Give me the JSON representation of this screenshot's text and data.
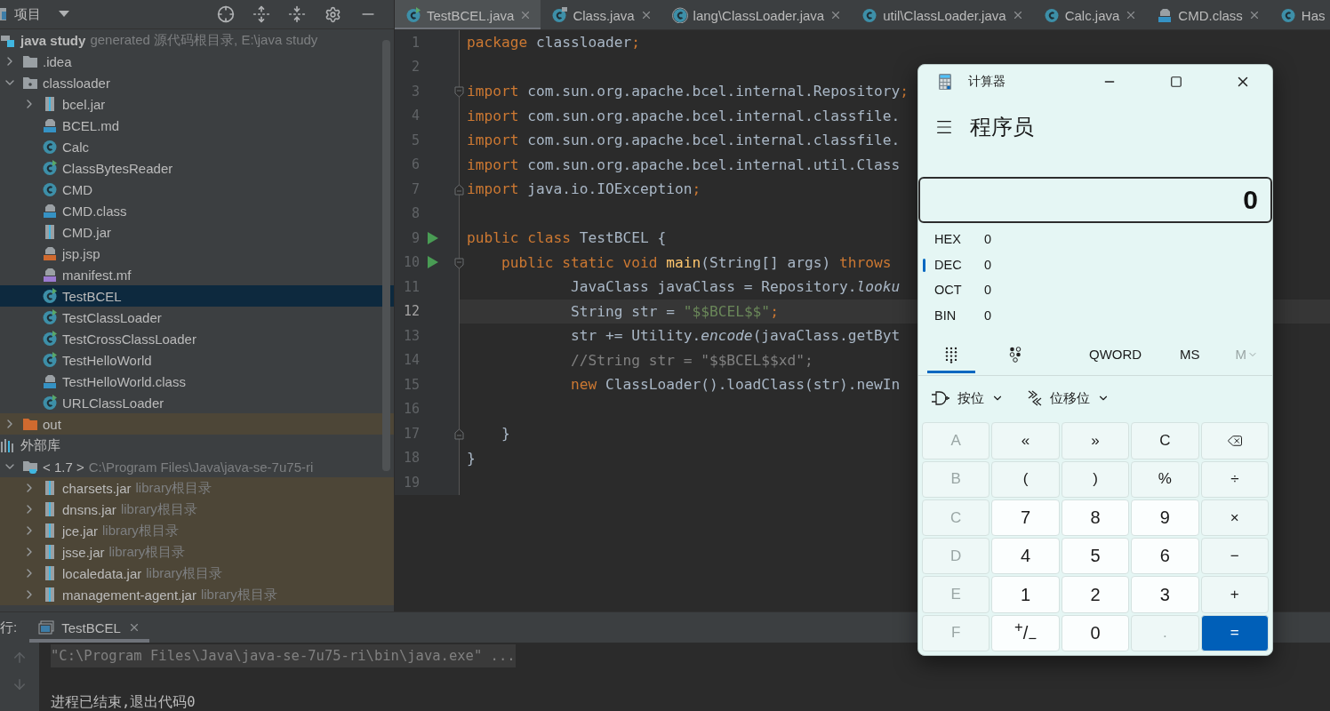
{
  "project_panel": {
    "title": "项目",
    "tree": [
      {
        "name": "java study",
        "hint": "generated 源代码根目录, E:\\java study",
        "kind": "module",
        "selected": false,
        "children": [
          {
            "name": ".idea",
            "kind": "folder",
            "expanded": false,
            "selected": false
          },
          {
            "name": "classloader",
            "kind": "package",
            "expanded": true,
            "selected": false,
            "children": [
              {
                "name": "bcel.jar",
                "kind": "jar",
                "expanded": false,
                "selected": false
              },
              {
                "name": "BCEL.md",
                "kind": "md",
                "selected": false
              },
              {
                "name": "Calc",
                "kind": "class",
                "selected": false
              },
              {
                "name": "ClassBytesReader",
                "kind": "class-runnable",
                "selected": false
              },
              {
                "name": "CMD",
                "kind": "class",
                "selected": false
              },
              {
                "name": "CMD.class",
                "kind": "binary",
                "selected": false
              },
              {
                "name": "CMD.jar",
                "kind": "jar",
                "selected": false
              },
              {
                "name": "jsp.jsp",
                "kind": "jsp",
                "selected": false
              },
              {
                "name": "manifest.mf",
                "kind": "mf",
                "selected": false
              },
              {
                "name": "TestBCEL",
                "kind": "class-runnable",
                "selected": true
              },
              {
                "name": "TestClassLoader",
                "kind": "class-runnable",
                "selected": false
              },
              {
                "name": "TestCrossClassLoader",
                "kind": "class-runnable",
                "selected": false
              },
              {
                "name": "TestHelloWorld",
                "kind": "class-runnable",
                "selected": false
              },
              {
                "name": "TestHelloWorld.class",
                "kind": "binary",
                "selected": false
              },
              {
                "name": "URLClassLoader",
                "kind": "class-runnable",
                "selected": false
              }
            ]
          },
          {
            "name": "out",
            "kind": "excluded",
            "expanded": false,
            "selected": false,
            "tinted": true
          }
        ]
      },
      {
        "name": "外部库",
        "kind": "libraries",
        "selected": false,
        "children": [
          {
            "name": "< 1.7 >",
            "hint": "C:\\Program Files\\Java\\java-se-7u75-ri",
            "kind": "jdk",
            "expanded": true,
            "selected": false,
            "children": [
              {
                "name": "charsets.jar",
                "hint": "library根目录",
                "kind": "jar",
                "expanded": false,
                "selected": false,
                "tinted": true
              },
              {
                "name": "dnsns.jar",
                "hint": "library根目录",
                "kind": "jar",
                "expanded": false,
                "selected": false,
                "tinted": true
              },
              {
                "name": "jce.jar",
                "hint": "library根目录",
                "kind": "jar",
                "expanded": false,
                "selected": false,
                "tinted": true
              },
              {
                "name": "jsse.jar",
                "hint": "library根目录",
                "kind": "jar",
                "expanded": false,
                "selected": false,
                "tinted": true
              },
              {
                "name": "localedata.jar",
                "hint": "library根目录",
                "kind": "jar",
                "expanded": false,
                "selected": false,
                "tinted": true
              },
              {
                "name": "management-agent.jar",
                "hint": "library根目录",
                "kind": "jar",
                "expanded": false,
                "selected": false,
                "tinted": true
              }
            ]
          }
        ]
      }
    ]
  },
  "editor": {
    "tabs": [
      {
        "label": "TestBCEL.java",
        "kind": "class-runnable",
        "selected": true,
        "closable": true
      },
      {
        "label": "Class.java",
        "kind": "class-locked",
        "selected": false,
        "closable": true
      },
      {
        "label": "lang\\ClassLoader.java",
        "kind": "class-abstract",
        "selected": false,
        "closable": true
      },
      {
        "label": "util\\ClassLoader.java",
        "kind": "class",
        "selected": false,
        "closable": true
      },
      {
        "label": "Calc.java",
        "kind": "class",
        "selected": false,
        "closable": true
      },
      {
        "label": "CMD.class",
        "kind": "binary",
        "selected": false,
        "closable": true
      },
      {
        "label": "Has",
        "kind": "class",
        "selected": false,
        "closable": false
      }
    ],
    "lines": [
      {
        "number": "1",
        "current": false,
        "tokens": [
          {
            "t": "package",
            "kind": "keyword"
          },
          {
            "t": " classloader",
            "kind": "plain"
          },
          {
            "t": ";",
            "kind": "keyword"
          }
        ]
      },
      {
        "number": "2",
        "current": false
      },
      {
        "number": "3",
        "current": false,
        "fold_start": true,
        "tokens": [
          {
            "t": "import",
            "kind": "keyword"
          },
          {
            "t": " com.sun.org.apache.bcel.internal.Repository",
            "kind": "plain"
          },
          {
            "t": ";",
            "kind": "keyword"
          }
        ]
      },
      {
        "number": "4",
        "current": false,
        "tokens": [
          {
            "t": "import",
            "kind": "keyword"
          },
          {
            "t": " com.sun.org.apache.bcel.internal.classfile.",
            "kind": "plain"
          }
        ]
      },
      {
        "number": "5",
        "current": false,
        "tokens": [
          {
            "t": "import",
            "kind": "keyword"
          },
          {
            "t": " com.sun.org.apache.bcel.internal.classfile.",
            "kind": "plain"
          }
        ]
      },
      {
        "number": "6",
        "current": false,
        "tokens": [
          {
            "t": "import",
            "kind": "keyword"
          },
          {
            "t": " com.sun.org.apache.bcel.internal.util.Class",
            "kind": "plain"
          }
        ]
      },
      {
        "number": "7",
        "current": false,
        "fold_end": true,
        "tokens": [
          {
            "t": "import",
            "kind": "keyword"
          },
          {
            "t": " java.io.IOException",
            "kind": "plain"
          },
          {
            "t": ";",
            "kind": "keyword"
          }
        ]
      },
      {
        "number": "8",
        "current": false
      },
      {
        "number": "9",
        "current": false,
        "run": true,
        "tokens": [
          {
            "t": "public class",
            "kind": "keyword"
          },
          {
            "t": " TestBCEL {",
            "kind": "plain"
          }
        ]
      },
      {
        "number": "10",
        "current": false,
        "run": true,
        "fold_start": true,
        "tokens": [
          {
            "t": "    public static void",
            "kind": "keyword"
          },
          {
            "t": " main",
            "kind": "function"
          },
          {
            "t": "(String[] args) ",
            "kind": "plain"
          },
          {
            "t": "throws",
            "kind": "keyword"
          }
        ]
      },
      {
        "number": "11",
        "current": false,
        "tokens": [
          {
            "t": "            JavaClass javaClass = Repository.",
            "kind": "plain"
          },
          {
            "t": "looku",
            "kind": "static"
          }
        ]
      },
      {
        "number": "12",
        "current": true,
        "tokens": [
          {
            "t": "            String str = ",
            "kind": "plain"
          },
          {
            "t": "\"$$BCEL$$\"",
            "kind": "string"
          },
          {
            "t": ";",
            "kind": "keyword"
          }
        ]
      },
      {
        "number": "13",
        "current": false,
        "tokens": [
          {
            "t": "            str += Utility.",
            "kind": "plain"
          },
          {
            "t": "encode",
            "kind": "static"
          },
          {
            "t": "(javaClass.getByt",
            "kind": "plain"
          }
        ]
      },
      {
        "number": "14",
        "current": false,
        "tokens": [
          {
            "t": "            //String str = \"$$BCEL$$xd\";",
            "kind": "comment"
          }
        ]
      },
      {
        "number": "15",
        "current": false,
        "tokens": [
          {
            "t": "            new",
            "kind": "keyword"
          },
          {
            "t": " ClassLoader().loadClass(str).newIn",
            "kind": "plain"
          }
        ]
      },
      {
        "number": "16",
        "current": false
      },
      {
        "number": "17",
        "current": false,
        "fold_end": true,
        "tokens": [
          {
            "t": "    }",
            "kind": "plain"
          }
        ]
      },
      {
        "number": "18",
        "current": false,
        "tokens": [
          {
            "t": "}",
            "kind": "plain"
          }
        ]
      },
      {
        "number": "19",
        "current": false
      }
    ]
  },
  "run_panel": {
    "label": "行:",
    "tabs": [
      {
        "label": "TestBCEL",
        "selected": true
      }
    ],
    "lines": [
      {
        "text": "\"C:\\Program Files\\Java\\java-se-7u75-ri\\bin\\java.exe\" ...",
        "kind": "command"
      },
      {
        "text": "进程已结束,退出代码0",
        "kind": "output"
      }
    ]
  },
  "calculator": {
    "title": "计算器",
    "mode": "程序员",
    "display": "0",
    "radix": [
      {
        "label": "HEX",
        "value": "0",
        "selected": false
      },
      {
        "label": "DEC",
        "value": "0",
        "selected": true
      },
      {
        "label": "OCT",
        "value": "0",
        "selected": false
      },
      {
        "label": "BIN",
        "value": "0",
        "selected": false
      }
    ],
    "pads": [
      {
        "kind": "keypad",
        "selected": true
      },
      {
        "kind": "bits",
        "selected": false
      }
    ],
    "word_size": "QWORD",
    "memory": [
      {
        "label": "MS",
        "kind": "store",
        "disabled": false
      },
      {
        "label": "M",
        "kind": "menu",
        "disabled": true
      }
    ],
    "menus": [
      {
        "label": "按位",
        "kind": "bitwise"
      },
      {
        "label": "位移位",
        "kind": "shift"
      }
    ],
    "keys": [
      {
        "label": "A",
        "kind": "op",
        "disabled": true
      },
      {
        "label": "«",
        "kind": "op",
        "disabled": false
      },
      {
        "label": "»",
        "kind": "op",
        "disabled": false
      },
      {
        "label": "C",
        "kind": "op",
        "disabled": false
      },
      {
        "kind": "backspace",
        "disabled": false
      },
      {
        "label": "B",
        "kind": "op",
        "disabled": true
      },
      {
        "label": "(",
        "kind": "op",
        "disabled": false
      },
      {
        "label": ")",
        "kind": "op",
        "disabled": false
      },
      {
        "label": "%",
        "kind": "op",
        "disabled": false
      },
      {
        "label": "÷",
        "kind": "op",
        "disabled": false
      },
      {
        "label": "C",
        "kind": "op",
        "disabled": true
      },
      {
        "label": "7",
        "kind": "digit",
        "disabled": false
      },
      {
        "label": "8",
        "kind": "digit",
        "disabled": false
      },
      {
        "label": "9",
        "kind": "digit",
        "disabled": false
      },
      {
        "label": "×",
        "kind": "op",
        "disabled": false
      },
      {
        "label": "D",
        "kind": "op",
        "disabled": true
      },
      {
        "label": "4",
        "kind": "digit",
        "disabled": false
      },
      {
        "label": "5",
        "kind": "digit",
        "disabled": false
      },
      {
        "label": "6",
        "kind": "digit",
        "disabled": false
      },
      {
        "label": "−",
        "kind": "op",
        "disabled": false
      },
      {
        "label": "E",
        "kind": "op",
        "disabled": true
      },
      {
        "label": "1",
        "kind": "digit",
        "disabled": false
      },
      {
        "label": "2",
        "kind": "digit",
        "disabled": false
      },
      {
        "label": "3",
        "kind": "digit",
        "disabled": false
      },
      {
        "label": "+",
        "kind": "op",
        "disabled": false
      },
      {
        "label": "F",
        "kind": "op",
        "disabled": true
      },
      {
        "label": "$^{+}$/$_{−}$",
        "kind": "digit",
        "disabled": false
      },
      {
        "label": "0",
        "kind": "digit",
        "disabled": false
      },
      {
        "label": ".",
        "kind": "op",
        "disabled": true
      },
      {
        "label": "=",
        "kind": "equals",
        "disabled": false
      }
    ]
  }
}
